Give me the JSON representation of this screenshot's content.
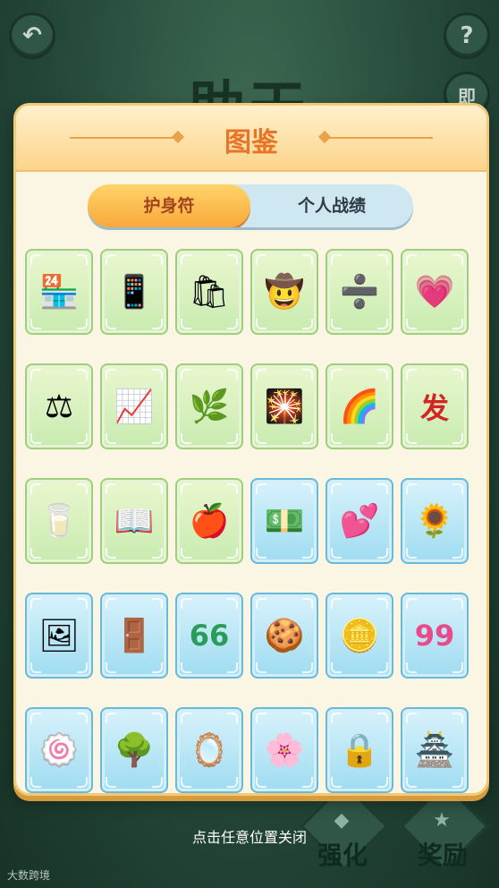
{
  "background": {
    "title": "助天",
    "back_icon": "back-arrow-icon",
    "help_label": "?",
    "side_label": "即",
    "buttons": [
      {
        "label": "强化",
        "icon": "diamond-icon"
      },
      {
        "label": "奖励",
        "icon": "star-icon"
      }
    ],
    "close_hint": "点击任意位置关闭",
    "watermark": "大数跨境"
  },
  "panel": {
    "title": "图鉴",
    "tabs": [
      {
        "label": "护身符",
        "active": true
      },
      {
        "label": "个人战绩",
        "active": false
      }
    ]
  },
  "amulets": [
    {
      "name": "shop-stall-icon",
      "glyph": "🏪",
      "frame": "green"
    },
    {
      "name": "phone-icon",
      "glyph": "📱",
      "frame": "green"
    },
    {
      "name": "shopping-bag-icon",
      "glyph": "🛍",
      "frame": "green"
    },
    {
      "name": "cowboy-hat-icon",
      "glyph": "🤠",
      "frame": "green"
    },
    {
      "name": "card-icon",
      "glyph": "➗",
      "frame": "green"
    },
    {
      "name": "heart-in-hands-icon",
      "glyph": "💗",
      "frame": "green"
    },
    {
      "name": "scale-icon",
      "glyph": "⚖",
      "frame": "green"
    },
    {
      "name": "rising-chart-icon",
      "glyph": "📈",
      "frame": "green"
    },
    {
      "name": "bamboo-shoot-icon",
      "glyph": "🌿",
      "frame": "green"
    },
    {
      "name": "firecracker-icon",
      "glyph": "🎇",
      "frame": "green"
    },
    {
      "name": "rainbow-pool-icon",
      "glyph": "🌈",
      "frame": "green"
    },
    {
      "name": "fortune-scroll-icon",
      "glyph": "发",
      "frame": "green"
    },
    {
      "name": "cups-icon",
      "glyph": "🥛",
      "frame": "green"
    },
    {
      "name": "open-book-icon",
      "glyph": "📖",
      "frame": "green"
    },
    {
      "name": "apple-icon",
      "glyph": "🍎",
      "frame": "green"
    },
    {
      "name": "money-stack-icon",
      "glyph": "💵",
      "frame": "blue"
    },
    {
      "name": "double-heart-icon",
      "glyph": "💕",
      "frame": "blue"
    },
    {
      "name": "sunflowers-icon",
      "glyph": "🌻",
      "frame": "blue"
    },
    {
      "name": "window-panel-icon",
      "glyph": "🖼",
      "frame": "blue"
    },
    {
      "name": "cabinet-icon",
      "glyph": "🚪",
      "frame": "blue"
    },
    {
      "name": "number-66-icon",
      "glyph": "66",
      "frame": "blue"
    },
    {
      "name": "cookie-plate-icon",
      "glyph": "🍪",
      "frame": "blue"
    },
    {
      "name": "gold-coins-icon",
      "glyph": "🪙",
      "frame": "blue"
    },
    {
      "name": "number-99-icon",
      "glyph": "99",
      "frame": "blue"
    },
    {
      "name": "swirl-cake-icon",
      "glyph": "🍥",
      "frame": "blue"
    },
    {
      "name": "tree-icon",
      "glyph": "🌳",
      "frame": "blue"
    },
    {
      "name": "portrait-frame-icon",
      "glyph": "🪞",
      "frame": "blue"
    },
    {
      "name": "magnolia-branch-icon",
      "glyph": "🌸",
      "frame": "blue"
    },
    {
      "name": "heart-lock-icon",
      "glyph": "🔒",
      "frame": "blue"
    },
    {
      "name": "courtyard-house-icon",
      "glyph": "🏯",
      "frame": "blue"
    },
    {
      "name": "yellow-item-icon",
      "glyph": "🧀",
      "frame": "blue"
    },
    {
      "name": "bunk-bed-icon",
      "glyph": "🛏",
      "frame": "blue"
    },
    {
      "name": "pink-item-icon",
      "glyph": "🎀",
      "frame": "blue"
    },
    {
      "name": "flower-pile-icon",
      "glyph": "💐",
      "frame": "blue"
    },
    {
      "name": "red-flower-icon",
      "glyph": "🌺",
      "frame": "blue"
    },
    {
      "name": "blue-flower-icon",
      "glyph": "🪻",
      "frame": "blue"
    }
  ]
}
